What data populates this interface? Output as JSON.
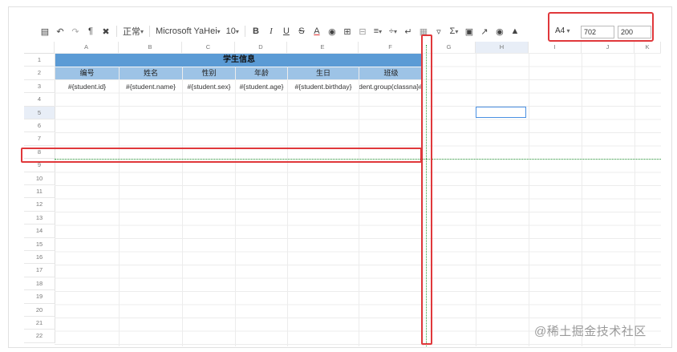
{
  "toolbar": {
    "items": [
      "💾",
      "↶",
      "↷",
      "⌖",
      "✕"
    ],
    "style_label": "正常",
    "font_label": "Microsoft YaHei",
    "size_label": "10",
    "bold": "B",
    "italic": "I",
    "underline": "U",
    "strike": "S",
    "fontcolor": "A",
    "sigma": "Σ"
  },
  "page_size": {
    "paper": "A4",
    "width": "702",
    "height": "200"
  },
  "columns": [
    "A",
    "B",
    "C",
    "D",
    "E",
    "F",
    "G",
    "H",
    "I",
    "J",
    "K"
  ],
  "rows": [
    "1",
    "2",
    "3",
    "4",
    "5",
    "6",
    "7",
    "8",
    "9",
    "10",
    "11",
    "12",
    "13",
    "14",
    "15",
    "16",
    "17",
    "18",
    "19",
    "20",
    "21",
    "22"
  ],
  "sheet": {
    "title": "学生信息",
    "headers": [
      "编号",
      "姓名",
      "性别",
      "年龄",
      "生日",
      "班级"
    ],
    "fields": [
      "#{student.id}",
      "#{student.name}",
      "#{student.sex}",
      "#{student.age}",
      "#{student.birthday}",
      "#{student.group(classna"
    ]
  },
  "watermark": "@稀土掘金技术社区"
}
